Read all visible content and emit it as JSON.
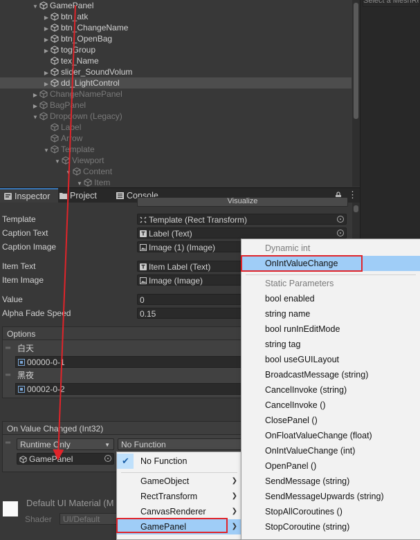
{
  "hierarchy": {
    "items": [
      {
        "label": "GamePanel",
        "arrow": "▼"
      },
      {
        "label": "btn_atk",
        "arrow": "▶"
      },
      {
        "label": "btn_ChangeName",
        "arrow": "▶"
      },
      {
        "label": "btn_OpenBag",
        "arrow": "▶"
      },
      {
        "label": "togGroup",
        "arrow": "▶"
      },
      {
        "label": "tex_Name",
        "arrow": ""
      },
      {
        "label": "slider_SoundVolum",
        "arrow": "▶"
      },
      {
        "label": "dd_LightControl",
        "arrow": "▶"
      },
      {
        "label": "ChangeNamePanel",
        "arrow": "▶"
      },
      {
        "label": "BagPanel",
        "arrow": "▶"
      },
      {
        "label": "Dropdown (Legacy)",
        "arrow": "▼"
      },
      {
        "label": "Label",
        "arrow": ""
      },
      {
        "label": "Arrow",
        "arrow": ""
      },
      {
        "label": "Template",
        "arrow": "▼"
      },
      {
        "label": "Viewport",
        "arrow": "▼"
      },
      {
        "label": "Content",
        "arrow": "▼"
      },
      {
        "label": "Item",
        "arrow": "▼"
      }
    ]
  },
  "right_panel": {
    "field_text": "Select a MeshRe"
  },
  "tabs": {
    "inspector": "Inspector",
    "project": "Project",
    "console": "Console"
  },
  "inspector": {
    "top_button": "Visualize",
    "template_label": "Template",
    "template_value": "Template (Rect Transform)",
    "caption_text_label": "Caption Text",
    "caption_text_value": "Label (Text)",
    "caption_image_label": "Caption Image",
    "caption_image_value": "Image (1) (Image)",
    "item_text_label": "Item Text",
    "item_text_value": "Item Label (Text)",
    "item_image_label": "Item Image",
    "item_image_value": "Image (Image)",
    "value_label": "Value",
    "value_value": "0",
    "alpha_label": "Alpha Fade Speed",
    "alpha_value": "0.15",
    "options_header": "Options",
    "options": [
      {
        "text": "白天",
        "image": "00000-0-1"
      },
      {
        "text": "黑夜",
        "image": "00002-0-2"
      }
    ],
    "event_header": "On Value Changed (Int32)",
    "runtime": "Runtime Only",
    "function": "No Function",
    "target": "GamePanel",
    "material_label": "Default UI Material (M",
    "shader_label": "Shader",
    "shader_value": "UI/Default"
  },
  "function_menu": {
    "items": [
      "No Function",
      "GameObject",
      "RectTransform",
      "CanvasRenderer",
      "GamePanel"
    ],
    "selected": "No Function",
    "highlighted": "GamePanel"
  },
  "method_menu": {
    "dynamic_header": "Dynamic int",
    "dynamic_items": [
      "OnIntValueChange"
    ],
    "static_header": "Static Parameters",
    "static_items": [
      "bool enabled",
      "string name",
      "bool runInEditMode",
      "string tag",
      "bool useGUILayout",
      "BroadcastMessage (string)",
      "CancelInvoke (string)",
      "CancelInvoke ()",
      "ClosePanel ()",
      "OnFloatValueChange (float)",
      "OnIntValueChange (int)",
      "OpenPanel ()",
      "SendMessage (string)",
      "SendMessageUpwards (string)",
      "StopAllCoroutines ()",
      "StopCoroutine (string)"
    ]
  },
  "colors": {
    "annotation_red": "#e0242a",
    "highlight": "#9fcdf7",
    "tab_accent": "#3a79bb"
  }
}
